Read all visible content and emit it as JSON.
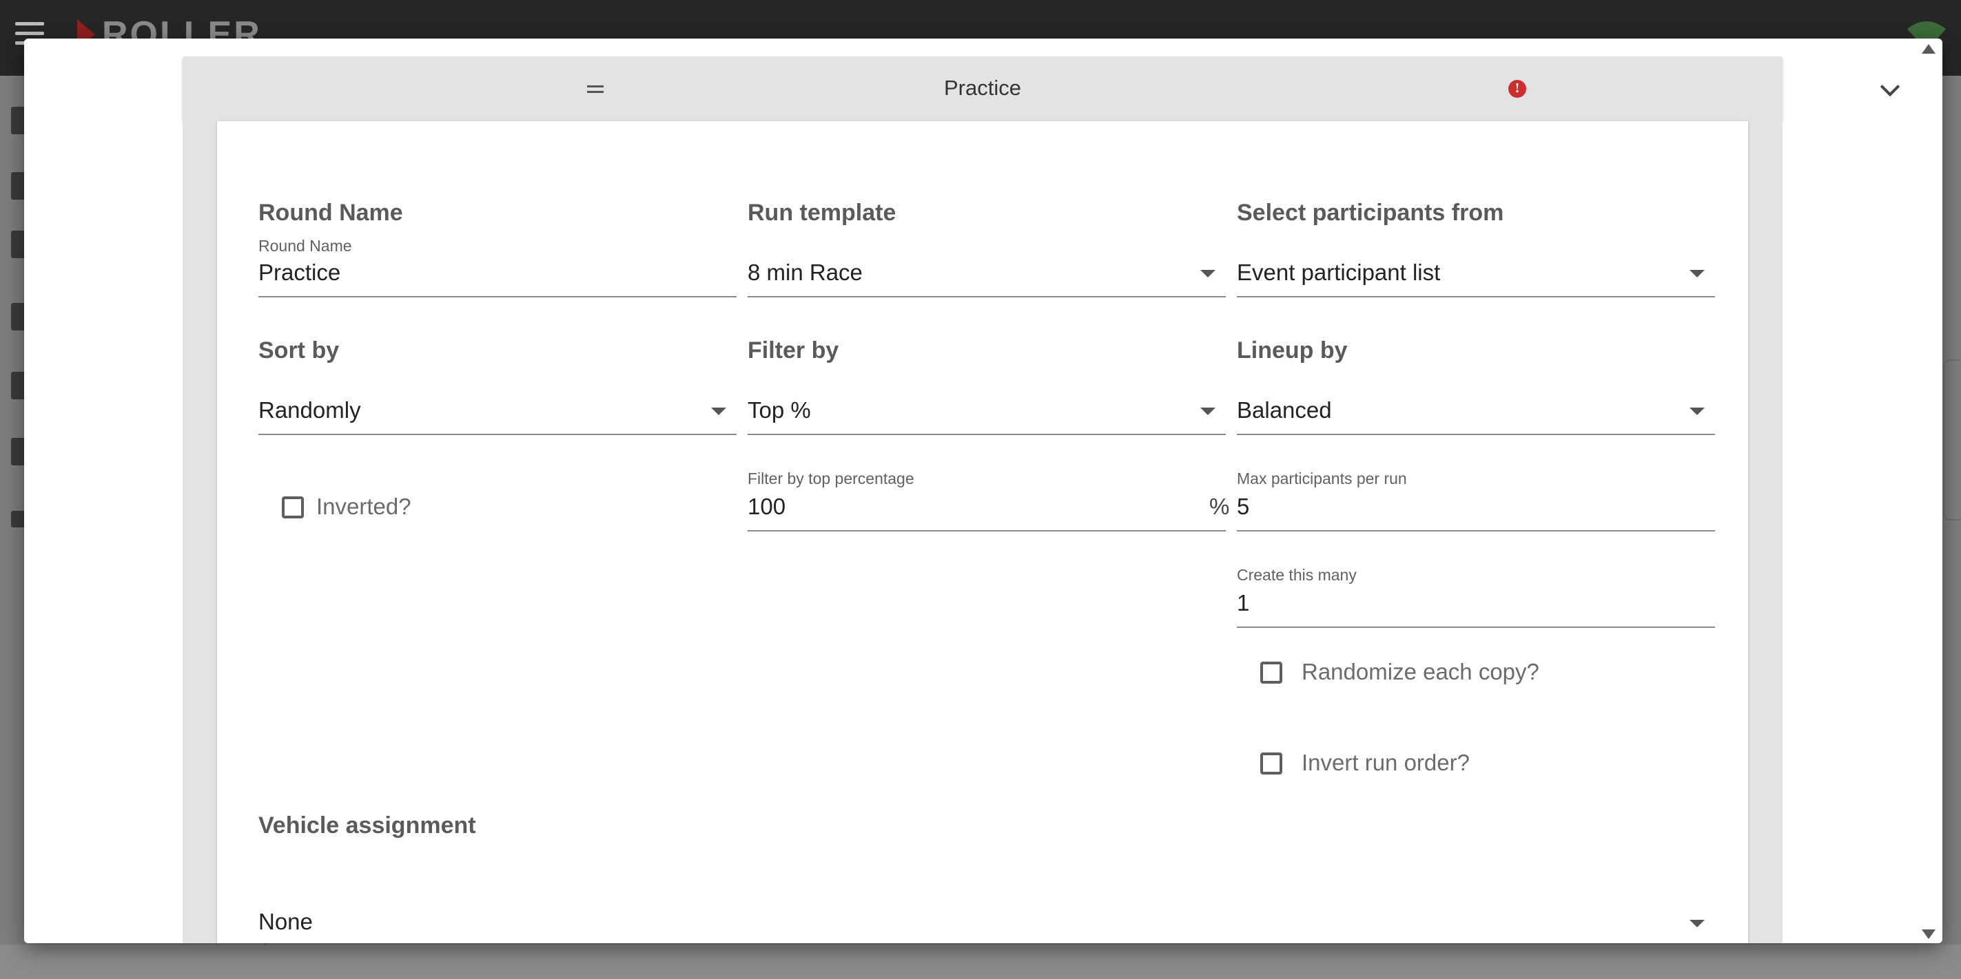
{
  "app": {
    "logo_text": "ROLLER"
  },
  "panel": {
    "title": "Practice",
    "error_icon_glyph": "!"
  },
  "round_name": {
    "section": "Round Name",
    "label": "Round Name",
    "value": "Practice"
  },
  "run_template": {
    "section": "Run template",
    "value": "8 min Race"
  },
  "participants_from": {
    "section": "Select participants from",
    "value": "Event participant list"
  },
  "sort_by": {
    "section": "Sort by",
    "value": "Randomly"
  },
  "filter_by": {
    "section": "Filter by",
    "value": "Top %"
  },
  "lineup_by": {
    "section": "Lineup by",
    "value": "Balanced"
  },
  "inverted": {
    "label": "Inverted?",
    "checked": false
  },
  "filter_pct": {
    "label": "Filter by top percentage",
    "value": "100",
    "suffix": "%"
  },
  "max_participants": {
    "label": "Max participants per run",
    "value": "5"
  },
  "create_many": {
    "label": "Create this many",
    "value": "1"
  },
  "randomize_copy": {
    "label": "Randomize each copy?",
    "checked": false
  },
  "invert_run_order": {
    "label": "Invert run order?",
    "checked": false
  },
  "vehicle_assignment": {
    "section": "Vehicle assignment",
    "value": "None"
  },
  "colors": {
    "accent_error": "#cf2e2e",
    "header_bg": "#e3e3e3",
    "appbar_bg": "#262626"
  }
}
